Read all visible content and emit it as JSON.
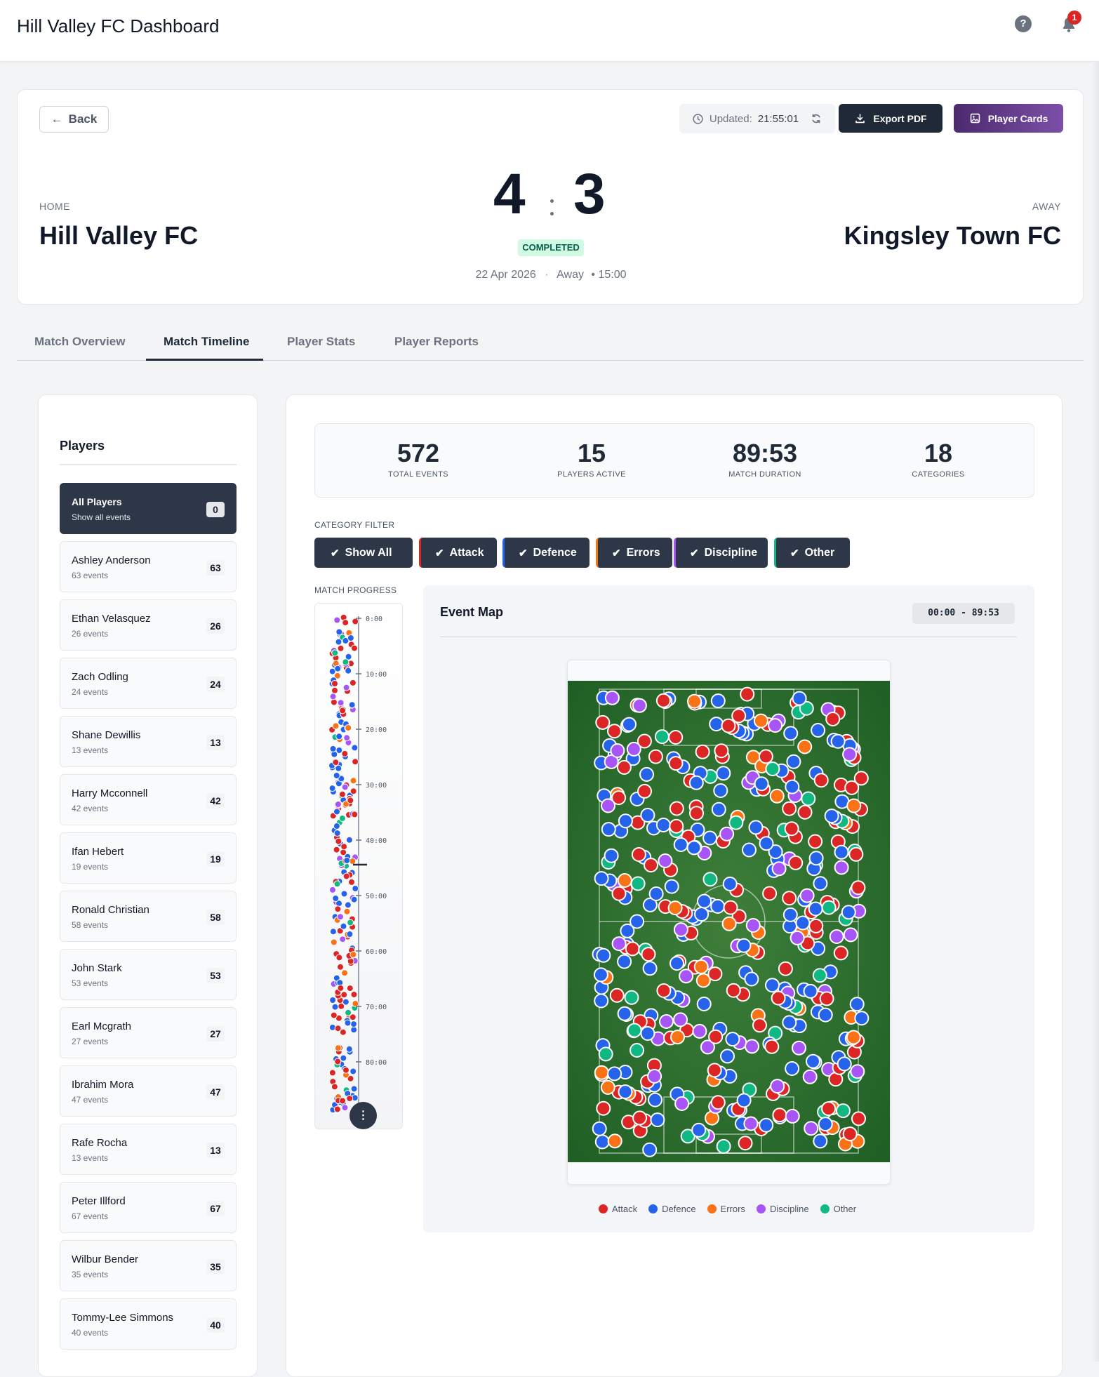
{
  "header": {
    "title": "Hill Valley FC Dashboard",
    "notification_count": "1"
  },
  "match": {
    "back_label": "Back",
    "updated_label": "Updated:",
    "updated_time": "21:55:01",
    "export_label": "Export PDF",
    "cards_label": "Player Cards",
    "home_label": "HOME",
    "home_team": "Hill Valley FC",
    "away_label": "AWAY",
    "away_team": "Kingsley Town FC",
    "home_score": "4",
    "away_score": "3",
    "status": "COMPLETED",
    "date": "22 Apr 2026",
    "venue": "Away",
    "kickoff": "• 15:00"
  },
  "tabs": [
    "Match Overview",
    "Match Timeline",
    "Player Stats",
    "Player Reports"
  ],
  "players_panel": {
    "title": "Players",
    "all": {
      "name": "All Players",
      "sub": "Show all events",
      "count": "0"
    },
    "list": [
      {
        "name": "Ashley Anderson",
        "events": "63 events",
        "count": "63"
      },
      {
        "name": "Ethan Velasquez",
        "events": "26 events",
        "count": "26"
      },
      {
        "name": "Zach Odling",
        "events": "24 events",
        "count": "24"
      },
      {
        "name": "Shane Dewillis",
        "events": "13 events",
        "count": "13"
      },
      {
        "name": "Harry Mcconnell",
        "events": "42 events",
        "count": "42"
      },
      {
        "name": "Ifan Hebert",
        "events": "19 events",
        "count": "19"
      },
      {
        "name": "Ronald Christian",
        "events": "58 events",
        "count": "58"
      },
      {
        "name": "John Stark",
        "events": "53 events",
        "count": "53"
      },
      {
        "name": "Earl Mcgrath",
        "events": "27 events",
        "count": "27"
      },
      {
        "name": "Ibrahim Mora",
        "events": "47 events",
        "count": "47"
      },
      {
        "name": "Rafe Rocha",
        "events": "13 events",
        "count": "13"
      },
      {
        "name": "Peter Illford",
        "events": "67 events",
        "count": "67"
      },
      {
        "name": "Wilbur Bender",
        "events": "35 events",
        "count": "35"
      },
      {
        "name": "Tommy-Lee Simmons",
        "events": "40 events",
        "count": "40"
      }
    ]
  },
  "stats": [
    {
      "value": "572",
      "label": "TOTAL EVENTS"
    },
    {
      "value": "15",
      "label": "PLAYERS ACTIVE"
    },
    {
      "value": "89:53",
      "label": "MATCH DURATION"
    },
    {
      "value": "18",
      "label": "CATEGORIES"
    }
  ],
  "category_filter": {
    "label": "CATEGORY FILTER",
    "chips": [
      {
        "label": "Show All",
        "accent": "#2d3748"
      },
      {
        "label": "Attack",
        "accent": "#dc2626"
      },
      {
        "label": "Defence",
        "accent": "#2563eb"
      },
      {
        "label": "Errors",
        "accent": "#f97316"
      },
      {
        "label": "Discipline",
        "accent": "#a855f7"
      },
      {
        "label": "Other",
        "accent": "#10b981"
      }
    ]
  },
  "progress": {
    "label": "MATCH PROGRESS",
    "ticks": [
      "0:00",
      "10:00",
      "20:00",
      "30:00",
      "40:00",
      "50:00",
      "60:00",
      "70:00",
      "80:00"
    ],
    "fab_icon": "more-vertical-icon"
  },
  "event_map": {
    "title": "Event Map",
    "range": "00:00 - 89:53",
    "legend": [
      {
        "label": "Attack",
        "color": "#dc2626"
      },
      {
        "label": "Defence",
        "color": "#2563eb"
      },
      {
        "label": "Errors",
        "color": "#f97316"
      },
      {
        "label": "Discipline",
        "color": "#a855f7"
      },
      {
        "label": "Other",
        "color": "#10b981"
      }
    ]
  }
}
